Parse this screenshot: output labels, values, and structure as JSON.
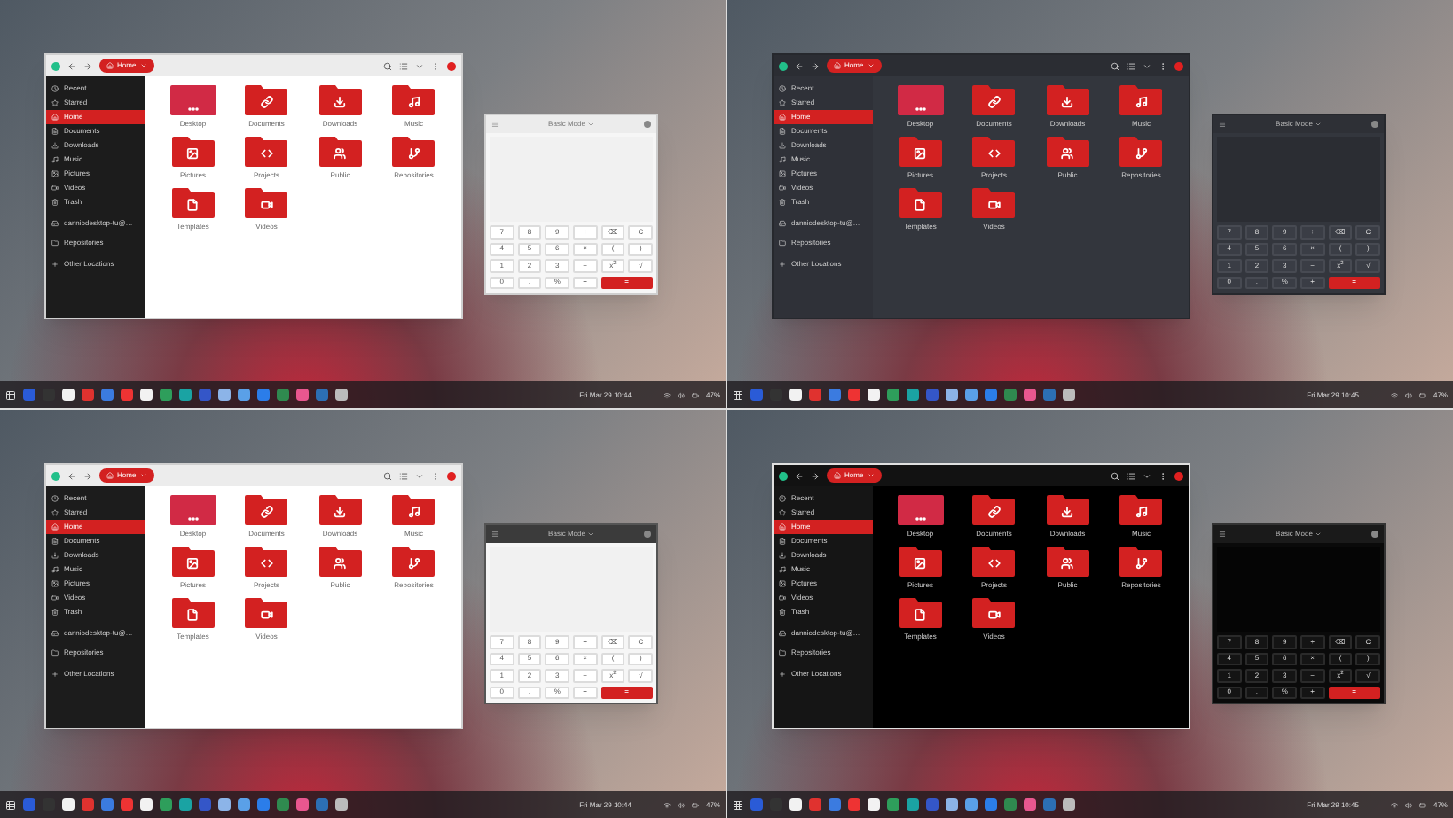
{
  "quadrants": [
    {
      "kind": "light",
      "file_manager": {
        "path": "Home",
        "sidebar": [
          {
            "label": "Recent",
            "kind": "recent",
            "selected": false
          },
          {
            "label": "Starred",
            "kind": "starred",
            "selected": false
          },
          {
            "label": "Home",
            "kind": "home",
            "selected": true
          },
          {
            "label": "Documents",
            "kind": "documents",
            "selected": false
          },
          {
            "label": "Downloads",
            "kind": "downloads",
            "selected": false
          },
          {
            "label": "Music",
            "kind": "music",
            "selected": false
          },
          {
            "label": "Pictures",
            "kind": "pictures",
            "selected": false
          },
          {
            "label": "Videos",
            "kind": "videos",
            "selected": false
          },
          {
            "label": "Trash",
            "kind": "trash",
            "selected": false
          },
          {
            "label": "danniodesktop-tu@…",
            "kind": "drive",
            "selected": false
          },
          {
            "label": "Repositories",
            "kind": "bookmark",
            "selected": false
          },
          {
            "label": "Other Locations",
            "kind": "other",
            "selected": false
          }
        ],
        "folders": [
          {
            "label": "Desktop",
            "kind": "desktop"
          },
          {
            "label": "Documents",
            "kind": "documents"
          },
          {
            "label": "Downloads",
            "kind": "downloads"
          },
          {
            "label": "Music",
            "kind": "music"
          },
          {
            "label": "Pictures",
            "kind": "pictures"
          },
          {
            "label": "Projects",
            "kind": "projects"
          },
          {
            "label": "Public",
            "kind": "public"
          },
          {
            "label": "Repositories",
            "kind": "repositories"
          },
          {
            "label": "Templates",
            "kind": "templates"
          },
          {
            "label": "Videos",
            "kind": "videos"
          }
        ]
      },
      "calculator": {
        "title": "Basic Mode",
        "keys": [
          {
            "label": "7",
            "kind": "normal"
          },
          {
            "label": "8",
            "kind": "normal"
          },
          {
            "label": "9",
            "kind": "normal"
          },
          {
            "label": "÷",
            "kind": "normal"
          },
          {
            "label": "⌫",
            "kind": "normal"
          },
          {
            "label": "C",
            "kind": "normal"
          },
          {
            "label": "4",
            "kind": "normal"
          },
          {
            "label": "5",
            "kind": "normal"
          },
          {
            "label": "6",
            "kind": "normal"
          },
          {
            "label": "×",
            "kind": "normal"
          },
          {
            "label": "(",
            "kind": "normal"
          },
          {
            "label": ")",
            "kind": "normal"
          },
          {
            "label": "1",
            "kind": "normal"
          },
          {
            "label": "2",
            "kind": "normal"
          },
          {
            "label": "3",
            "kind": "normal"
          },
          {
            "label": "−",
            "kind": "normal"
          },
          {
            "label": "x$^{2}$",
            "kind": "normal"
          },
          {
            "label": "√",
            "kind": "normal"
          },
          {
            "label": "0",
            "kind": "normal"
          },
          {
            "label": ".",
            "kind": "normal"
          },
          {
            "label": "%",
            "kind": "normal"
          },
          {
            "label": "+",
            "kind": "normal"
          },
          {
            "label": "=",
            "kind": "equals"
          }
        ]
      },
      "taskbar": {
        "clock": "Fri Mar 29 10:44",
        "battery": "47%"
      }
    },
    {
      "kind": "dark",
      "file_manager": {
        "path": "Home",
        "sidebar": [
          {
            "label": "Recent",
            "kind": "recent",
            "selected": false
          },
          {
            "label": "Starred",
            "kind": "starred",
            "selected": false
          },
          {
            "label": "Home",
            "kind": "home",
            "selected": true
          },
          {
            "label": "Documents",
            "kind": "documents",
            "selected": false
          },
          {
            "label": "Downloads",
            "kind": "downloads",
            "selected": false
          },
          {
            "label": "Music",
            "kind": "music",
            "selected": false
          },
          {
            "label": "Pictures",
            "kind": "pictures",
            "selected": false
          },
          {
            "label": "Videos",
            "kind": "videos",
            "selected": false
          },
          {
            "label": "Trash",
            "kind": "trash",
            "selected": false
          },
          {
            "label": "danniodesktop-tu@…",
            "kind": "drive",
            "selected": false
          },
          {
            "label": "Repositories",
            "kind": "bookmark",
            "selected": false
          },
          {
            "label": "Other Locations",
            "kind": "other",
            "selected": false
          }
        ],
        "folders": [
          {
            "label": "Desktop",
            "kind": "desktop"
          },
          {
            "label": "Documents",
            "kind": "documents"
          },
          {
            "label": "Downloads",
            "kind": "downloads"
          },
          {
            "label": "Music",
            "kind": "music"
          },
          {
            "label": "Pictures",
            "kind": "pictures"
          },
          {
            "label": "Projects",
            "kind": "projects"
          },
          {
            "label": "Public",
            "kind": "public"
          },
          {
            "label": "Repositories",
            "kind": "repositories"
          },
          {
            "label": "Templates",
            "kind": "templates"
          },
          {
            "label": "Videos",
            "kind": "videos"
          }
        ]
      },
      "calculator": {
        "title": "Basic Mode",
        "keys": [
          {
            "label": "7",
            "kind": "normal"
          },
          {
            "label": "8",
            "kind": "normal"
          },
          {
            "label": "9",
            "kind": "normal"
          },
          {
            "label": "÷",
            "kind": "normal"
          },
          {
            "label": "⌫",
            "kind": "normal"
          },
          {
            "label": "C",
            "kind": "normal"
          },
          {
            "label": "4",
            "kind": "normal"
          },
          {
            "label": "5",
            "kind": "normal"
          },
          {
            "label": "6",
            "kind": "normal"
          },
          {
            "label": "×",
            "kind": "normal"
          },
          {
            "label": "(",
            "kind": "normal"
          },
          {
            "label": ")",
            "kind": "normal"
          },
          {
            "label": "1",
            "kind": "normal"
          },
          {
            "label": "2",
            "kind": "normal"
          },
          {
            "label": "3",
            "kind": "normal"
          },
          {
            "label": "−",
            "kind": "normal"
          },
          {
            "label": "x$^{2}$",
            "kind": "normal"
          },
          {
            "label": "√",
            "kind": "normal"
          },
          {
            "label": "0",
            "kind": "normal"
          },
          {
            "label": ".",
            "kind": "normal"
          },
          {
            "label": "%",
            "kind": "normal"
          },
          {
            "label": "+",
            "kind": "normal"
          },
          {
            "label": "=",
            "kind": "equals"
          }
        ]
      },
      "taskbar": {
        "clock": "Fri Mar 29 10:45",
        "battery": "47%"
      }
    },
    {
      "kind": "mixed",
      "file_manager": {
        "path": "Home",
        "sidebar": [
          {
            "label": "Recent",
            "kind": "recent",
            "selected": false
          },
          {
            "label": "Starred",
            "kind": "starred",
            "selected": false
          },
          {
            "label": "Home",
            "kind": "home",
            "selected": true
          },
          {
            "label": "Documents",
            "kind": "documents",
            "selected": false
          },
          {
            "label": "Downloads",
            "kind": "downloads",
            "selected": false
          },
          {
            "label": "Music",
            "kind": "music",
            "selected": false
          },
          {
            "label": "Pictures",
            "kind": "pictures",
            "selected": false
          },
          {
            "label": "Videos",
            "kind": "videos",
            "selected": false
          },
          {
            "label": "Trash",
            "kind": "trash",
            "selected": false
          },
          {
            "label": "danniodesktop-tu@…",
            "kind": "drive",
            "selected": false
          },
          {
            "label": "Repositories",
            "kind": "bookmark",
            "selected": false
          },
          {
            "label": "Other Locations",
            "kind": "other",
            "selected": false
          }
        ],
        "folders": [
          {
            "label": "Desktop",
            "kind": "desktop"
          },
          {
            "label": "Documents",
            "kind": "documents"
          },
          {
            "label": "Downloads",
            "kind": "downloads"
          },
          {
            "label": "Music",
            "kind": "music"
          },
          {
            "label": "Pictures",
            "kind": "pictures"
          },
          {
            "label": "Projects",
            "kind": "projects"
          },
          {
            "label": "Public",
            "kind": "public"
          },
          {
            "label": "Repositories",
            "kind": "repositories"
          },
          {
            "label": "Templates",
            "kind": "templates"
          },
          {
            "label": "Videos",
            "kind": "videos"
          }
        ]
      },
      "calculator": {
        "title": "Basic Mode",
        "keys": [
          {
            "label": "7",
            "kind": "normal"
          },
          {
            "label": "8",
            "kind": "normal"
          },
          {
            "label": "9",
            "kind": "normal"
          },
          {
            "label": "÷",
            "kind": "normal"
          },
          {
            "label": "⌫",
            "kind": "normal"
          },
          {
            "label": "C",
            "kind": "normal"
          },
          {
            "label": "4",
            "kind": "normal"
          },
          {
            "label": "5",
            "kind": "normal"
          },
          {
            "label": "6",
            "kind": "normal"
          },
          {
            "label": "×",
            "kind": "normal"
          },
          {
            "label": "(",
            "kind": "normal"
          },
          {
            "label": ")",
            "kind": "normal"
          },
          {
            "label": "1",
            "kind": "normal"
          },
          {
            "label": "2",
            "kind": "normal"
          },
          {
            "label": "3",
            "kind": "normal"
          },
          {
            "label": "−",
            "kind": "normal"
          },
          {
            "label": "x$^{2}$",
            "kind": "normal"
          },
          {
            "label": "√",
            "kind": "normal"
          },
          {
            "label": "0",
            "kind": "normal"
          },
          {
            "label": ".",
            "kind": "normal"
          },
          {
            "label": "%",
            "kind": "normal"
          },
          {
            "label": "+",
            "kind": "normal"
          },
          {
            "label": "=",
            "kind": "equals"
          }
        ]
      },
      "taskbar": {
        "clock": "Fri Mar 29 10:44",
        "battery": "47%"
      }
    },
    {
      "kind": "black",
      "file_manager": {
        "path": "Home",
        "sidebar": [
          {
            "label": "Recent",
            "kind": "recent",
            "selected": false
          },
          {
            "label": "Starred",
            "kind": "starred",
            "selected": false
          },
          {
            "label": "Home",
            "kind": "home",
            "selected": true
          },
          {
            "label": "Documents",
            "kind": "documents",
            "selected": false
          },
          {
            "label": "Downloads",
            "kind": "downloads",
            "selected": false
          },
          {
            "label": "Music",
            "kind": "music",
            "selected": false
          },
          {
            "label": "Pictures",
            "kind": "pictures",
            "selected": false
          },
          {
            "label": "Videos",
            "kind": "videos",
            "selected": false
          },
          {
            "label": "Trash",
            "kind": "trash",
            "selected": false
          },
          {
            "label": "danniodesktop-tu@…",
            "kind": "drive",
            "selected": false
          },
          {
            "label": "Repositories",
            "kind": "bookmark",
            "selected": false
          },
          {
            "label": "Other Locations",
            "kind": "other",
            "selected": false
          }
        ],
        "folders": [
          {
            "label": "Desktop",
            "kind": "desktop"
          },
          {
            "label": "Documents",
            "kind": "documents"
          },
          {
            "label": "Downloads",
            "kind": "downloads"
          },
          {
            "label": "Music",
            "kind": "music"
          },
          {
            "label": "Pictures",
            "kind": "pictures"
          },
          {
            "label": "Projects",
            "kind": "projects"
          },
          {
            "label": "Public",
            "kind": "public"
          },
          {
            "label": "Repositories",
            "kind": "repositories"
          },
          {
            "label": "Templates",
            "kind": "templates"
          },
          {
            "label": "Videos",
            "kind": "videos"
          }
        ]
      },
      "calculator": {
        "title": "Basic Mode",
        "keys": [
          {
            "label": "7",
            "kind": "normal"
          },
          {
            "label": "8",
            "kind": "normal"
          },
          {
            "label": "9",
            "kind": "normal"
          },
          {
            "label": "÷",
            "kind": "normal"
          },
          {
            "label": "⌫",
            "kind": "normal"
          },
          {
            "label": "C",
            "kind": "normal"
          },
          {
            "label": "4",
            "kind": "normal"
          },
          {
            "label": "5",
            "kind": "normal"
          },
          {
            "label": "6",
            "kind": "normal"
          },
          {
            "label": "×",
            "kind": "normal"
          },
          {
            "label": "(",
            "kind": "normal"
          },
          {
            "label": ")",
            "kind": "normal"
          },
          {
            "label": "1",
            "kind": "normal"
          },
          {
            "label": "2",
            "kind": "normal"
          },
          {
            "label": "3",
            "kind": "normal"
          },
          {
            "label": "−",
            "kind": "normal"
          },
          {
            "label": "x$^{2}$",
            "kind": "normal"
          },
          {
            "label": "√",
            "kind": "normal"
          },
          {
            "label": "0",
            "kind": "normal"
          },
          {
            "label": ".",
            "kind": "normal"
          },
          {
            "label": "%",
            "kind": "normal"
          },
          {
            "label": "+",
            "kind": "normal"
          },
          {
            "label": "=",
            "kind": "equals"
          }
        ]
      },
      "taskbar": {
        "clock": "Fri Mar 29 10:45",
        "battery": "47%"
      }
    }
  ]
}
